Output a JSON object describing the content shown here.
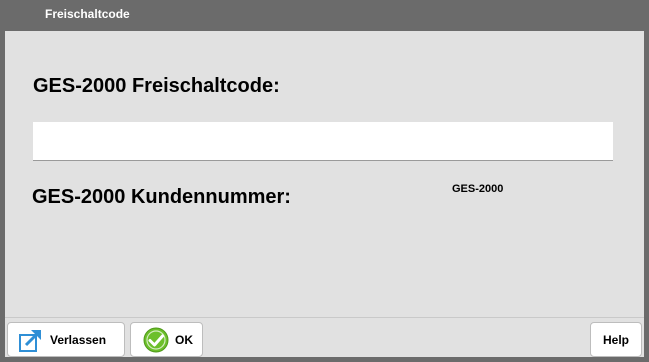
{
  "window": {
    "title": "Freischaltcode"
  },
  "form": {
    "code_label": "GES-2000 Freischaltcode:",
    "code_value": "",
    "customer_label": "GES-2000 Kundennummer:",
    "customer_value": "GES-2000"
  },
  "buttons": {
    "leave_label": "Verlassen",
    "leave_icon": "exit-arrow-icon",
    "ok_label": "OK",
    "ok_icon": "green-check-icon",
    "help_label": "Help"
  },
  "colors": {
    "titlebar": "#6b6b6b",
    "content_bg": "#e1e1e1",
    "ok_green": "#6cbf2a",
    "leave_blue": "#2f8fd6"
  }
}
